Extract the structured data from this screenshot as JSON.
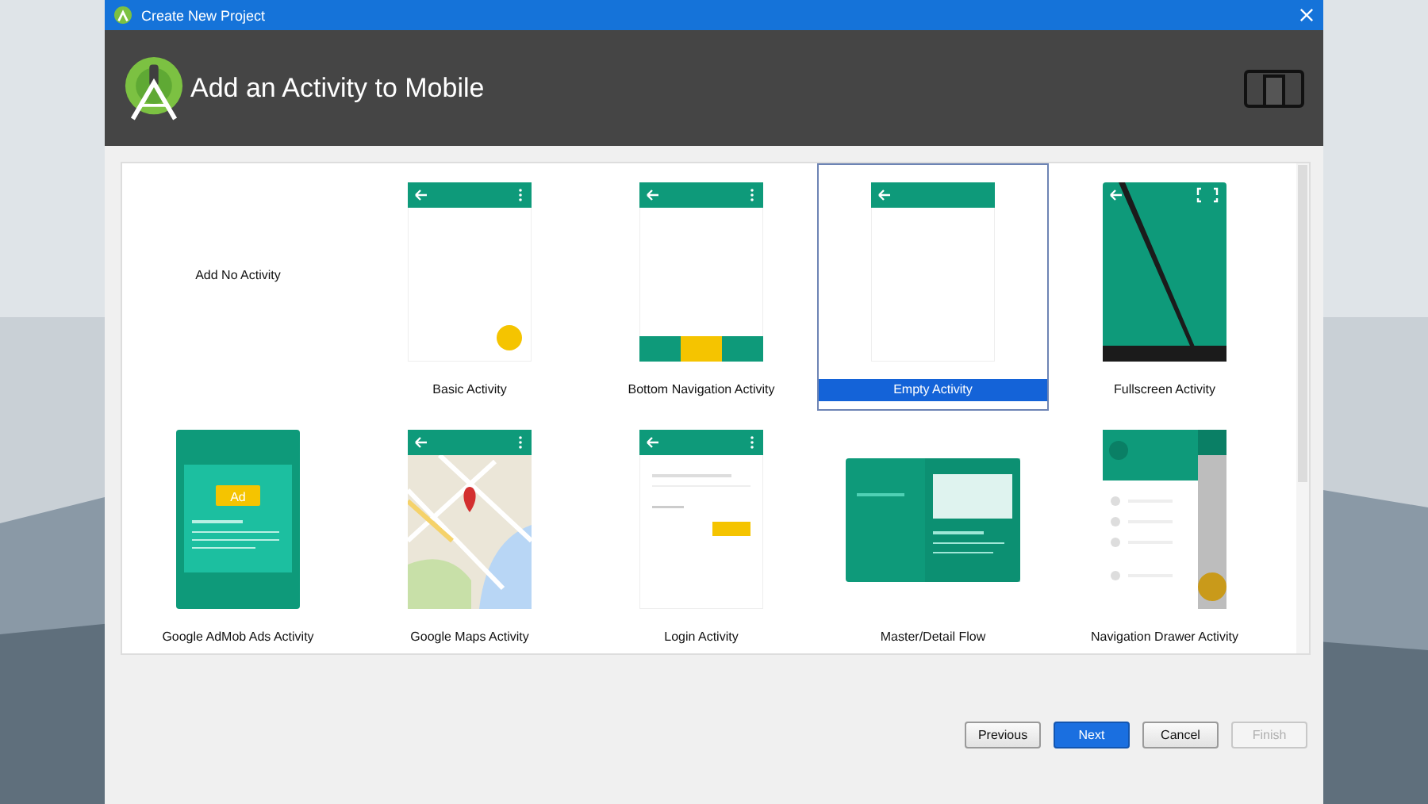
{
  "window": {
    "title": "Create New Project"
  },
  "header": {
    "title": "Add an Activity to Mobile"
  },
  "templates": [
    {
      "label": "Add No Activity",
      "kind": "none",
      "selected": false
    },
    {
      "label": "Basic Activity",
      "kind": "basic",
      "selected": false
    },
    {
      "label": "Bottom Navigation Activity",
      "kind": "bottomnav",
      "selected": false
    },
    {
      "label": "Empty Activity",
      "kind": "empty",
      "selected": true
    },
    {
      "label": "Fullscreen Activity",
      "kind": "fullscreen",
      "selected": false
    },
    {
      "label": "Google AdMob Ads Activity",
      "kind": "admob",
      "badge": "Ad",
      "selected": false
    },
    {
      "label": "Google Maps Activity",
      "kind": "maps",
      "selected": false
    },
    {
      "label": "Login Activity",
      "kind": "login",
      "selected": false
    },
    {
      "label": "Master/Detail Flow",
      "kind": "masterdetail",
      "selected": false
    },
    {
      "label": "Navigation Drawer Activity",
      "kind": "drawer",
      "selected": false
    }
  ],
  "buttons": [
    {
      "label": "Previous",
      "kind": "normal",
      "disabled": false
    },
    {
      "label": "Next",
      "kind": "primary",
      "disabled": false
    },
    {
      "label": "Cancel",
      "kind": "normal",
      "disabled": false
    },
    {
      "label": "Finish",
      "kind": "normal",
      "disabled": true
    }
  ]
}
